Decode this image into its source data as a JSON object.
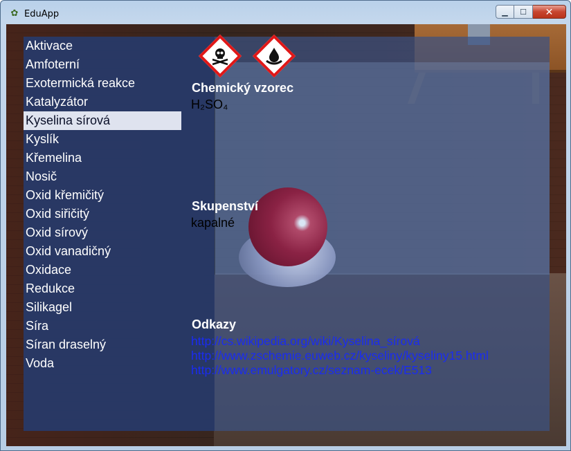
{
  "window": {
    "title": "EduApp",
    "app_icon": "app-logo-icon",
    "controls": {
      "minimize": "minimize-icon",
      "maximize": "maximize-icon",
      "close": "close-icon"
    }
  },
  "menu": {
    "items": [
      {
        "label": "Aktivace"
      },
      {
        "label": "Amfoterní"
      },
      {
        "label": "Exotermická reakce"
      },
      {
        "label": "Katalyzátor"
      },
      {
        "label": "Kyselina sírová",
        "selected": true
      },
      {
        "label": "Kyslík"
      },
      {
        "label": "Křemelina"
      },
      {
        "label": "Nosič"
      },
      {
        "label": "Oxid křemičitý"
      },
      {
        "label": "Oxid siřičitý"
      },
      {
        "label": "Oxid sírový"
      },
      {
        "label": "Oxid vanadičný"
      },
      {
        "label": "Oxidace"
      },
      {
        "label": "Redukce"
      },
      {
        "label": "Silikagel"
      },
      {
        "label": "Síra"
      },
      {
        "label": "Síran draselný"
      },
      {
        "label": "Voda"
      }
    ]
  },
  "detail": {
    "hazard_icons": [
      "toxic-skull-icon",
      "corrosive-icon"
    ],
    "formula": {
      "title": "Chemický vzorec",
      "value": "H₂SO₄"
    },
    "state": {
      "title": "Skupenství",
      "value": "kapalné"
    },
    "links": {
      "title": "Odkazy",
      "items": [
        "http://cs.wikipedia.org/wiki/Kyselina_sírová",
        "http://www.zschemie.euweb.cz/kyseliny/kyseliny15.html",
        "http://www.emulgatory.cz/seznam-ecek/E513"
      ]
    }
  },
  "colors": {
    "panel": "#3c5282",
    "selected_item_bg": "#dfe3ef",
    "link": "#1a2cf0",
    "hazard_border": "#e01818"
  }
}
